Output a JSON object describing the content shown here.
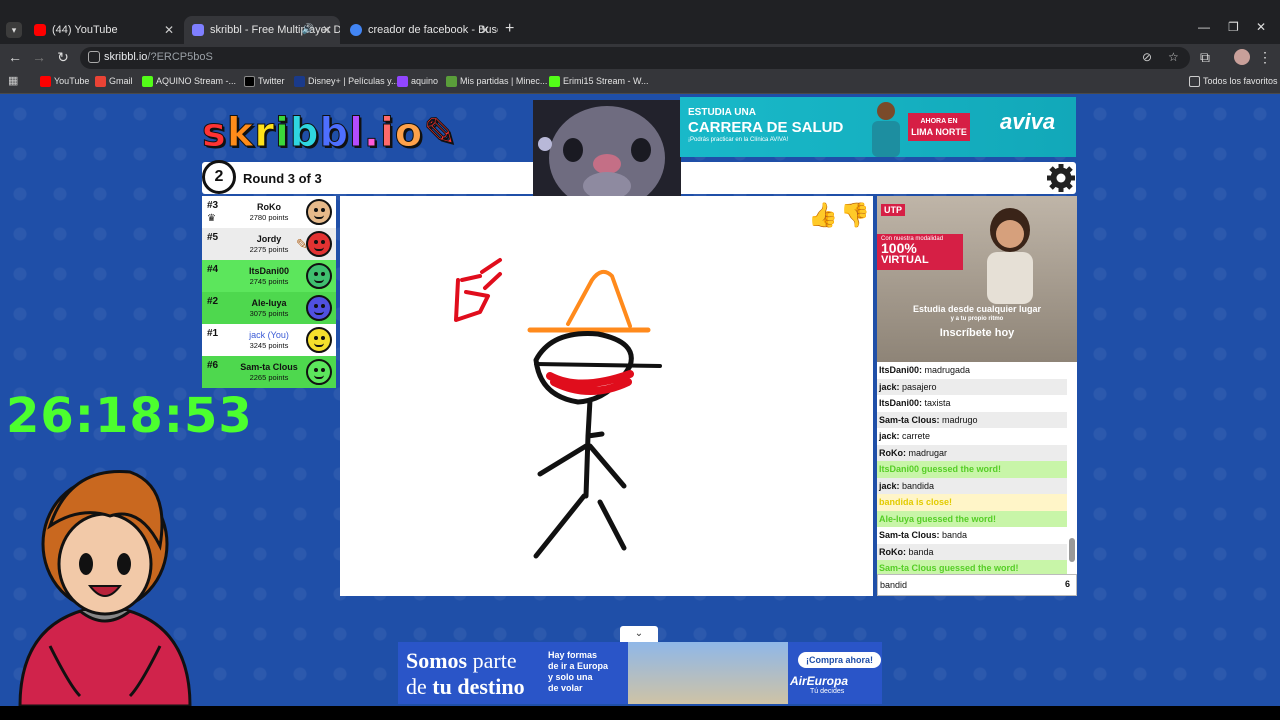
{
  "browser": {
    "tabs": [
      {
        "title": "(44) YouTube",
        "favicon_color": "#ff0000"
      },
      {
        "title": "skribbl - Free Multiplayer Dr",
        "favicon_color": "#7f7fff"
      },
      {
        "title": "creador de facebook - Buscar c",
        "favicon_color": "#4285f4"
      }
    ],
    "url_domain": "skribbl.io",
    "url_path": "/?ERCP5boS",
    "bookmarks": [
      {
        "label": "YouTube",
        "color": "#ff0000"
      },
      {
        "label": "Gmail",
        "color": "#ea4335"
      },
      {
        "label": "AQUINO Stream -...",
        "color": "#53fc18"
      },
      {
        "label": "Twitter",
        "color": "#000000"
      },
      {
        "label": "Disney+ | Películas y...",
        "color": "#1a3a8a"
      },
      {
        "label": "aquino",
        "color": "#9146ff"
      },
      {
        "label": "Mis partidas | Minec...",
        "color": "#5a9e3a"
      },
      {
        "label": "Erimi15 Stream - W...",
        "color": "#53fc18"
      }
    ],
    "all_bookmarks": "Todos los favoritos"
  },
  "game": {
    "logo": "skribbl.io",
    "clock_value": "2",
    "round_text": "Round 3 of 3",
    "players": [
      {
        "rank": "#3",
        "name": "RoKo",
        "points": "2780 points",
        "bg": "#ffffff",
        "face": "#e6b98a",
        "crown": true,
        "you": false
      },
      {
        "rank": "#5",
        "name": "Jordy",
        "points": "2275 points",
        "bg": "#ececec",
        "face": "#e23232",
        "crown": false,
        "you": false
      },
      {
        "rank": "#4",
        "name": "ItsDani00",
        "points": "2745 points",
        "bg": "#5ce65c",
        "face": "#3fbf6f",
        "crown": false,
        "you": false
      },
      {
        "rank": "#2",
        "name": "Ale-luya",
        "points": "3075 points",
        "bg": "#4ed84e",
        "face": "#5050e0",
        "crown": false,
        "you": false
      },
      {
        "rank": "#1",
        "name": "jack (You)",
        "points": "3245 points",
        "bg": "#ffffff",
        "face": "#f5e02c",
        "crown": false,
        "you": true
      },
      {
        "rank": "#6",
        "name": "Sam-ta Clous",
        "points": "2265 points",
        "bg": "#4ed84e",
        "face": "#5ce65c",
        "crown": false,
        "you": false
      }
    ],
    "chat": [
      {
        "name": "ItsDani00:",
        "text": "madrugada",
        "type": "msg"
      },
      {
        "name": "jack:",
        "text": "pasajero",
        "type": "msg"
      },
      {
        "name": "ItsDani00:",
        "text": "taxista",
        "type": "msg"
      },
      {
        "name": "Sam-ta Clous:",
        "text": "madrugo",
        "type": "msg"
      },
      {
        "name": "jack:",
        "text": "carrete",
        "type": "msg"
      },
      {
        "name": "RoKo:",
        "text": "madrugar",
        "type": "msg"
      },
      {
        "name": "",
        "text": "ItsDani00 guessed the word!",
        "type": "guess"
      },
      {
        "name": "jack:",
        "text": "bandida",
        "type": "msg"
      },
      {
        "name": "",
        "text": "bandida is close!",
        "type": "close"
      },
      {
        "name": "",
        "text": "Ale-luya guessed the word!",
        "type": "guess"
      },
      {
        "name": "Sam-ta Clous:",
        "text": "banda",
        "type": "msg"
      },
      {
        "name": "RoKo:",
        "text": "banda",
        "type": "msg"
      },
      {
        "name": "",
        "text": "Sam-ta Clous guessed the word!",
        "type": "guess"
      }
    ],
    "chat_input_value": "bandid",
    "chat_char_count": "6"
  },
  "overlay": {
    "timer": "26:18:53"
  },
  "ads": {
    "top": {
      "line1": "ESTUDIA UNA",
      "line2": "CARRERA DE SALUD",
      "line3": "¡Podrás practicar en la Clínica AVIVA!",
      "pill_top": "AHORA EN",
      "pill_bottom": "LIMA NORTE",
      "brand": "aviva"
    },
    "side": {
      "logo": "UTP",
      "red_small": "Con nuestra modalidad",
      "red_big": "100%",
      "red_mid": "VIRTUAL",
      "cap1": "Estudia desde cualquier lugar",
      "cap2": "y a tu propio ritmo",
      "cap3": "Inscríbete hoy"
    },
    "bottom": {
      "title_a": "Somos",
      "title_b": " parte",
      "title_c": "de",
      "title_d": " tu destino",
      "text": "Hay formas\nde ir a Europa\ny solo una\nde volar",
      "cta": "¡Compra ahora!",
      "brand": "AirEuropa",
      "tagline": "Tú decides"
    }
  },
  "colors": {
    "page_bg": "#1f4fa8",
    "timer": "#4cff2e",
    "guess": "#56ce27",
    "close": "#e2cb00"
  }
}
